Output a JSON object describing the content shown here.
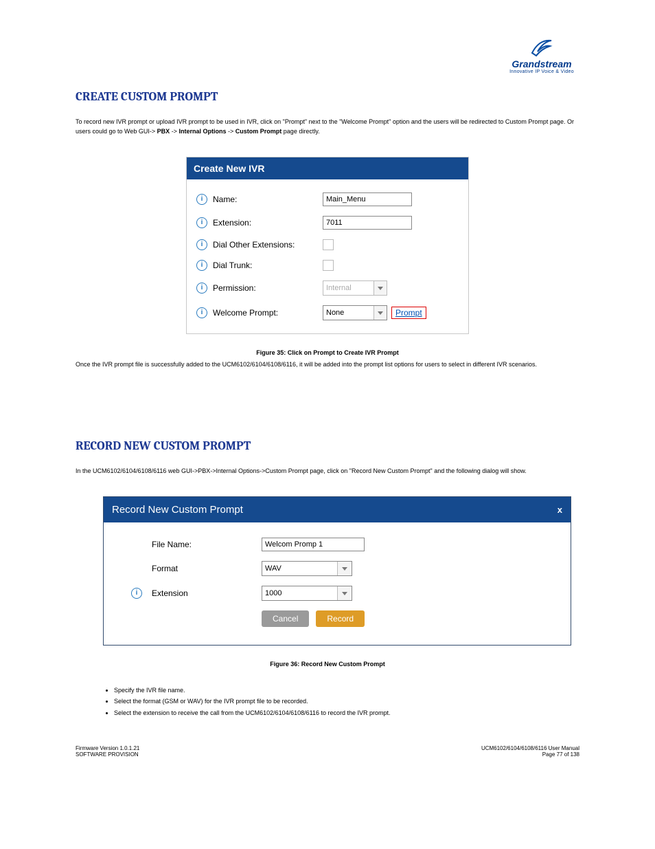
{
  "logo": {
    "brand": "Grandstream",
    "tagline": "Innovative IP Voice & Video"
  },
  "section1": {
    "heading": "CREATE CUSTOM PROMPT",
    "para1_a": "To record new IVR prompt or upload IVR prompt to be used in IVR, click on \"Prompt\" next to the \"Welcome Prompt\" option and the users will be redirected to Custom Prompt page. Or users could go to Web GUI->",
    "para1_b": "PBX",
    "para1_c": "->",
    "para1_d": "Internal Options",
    "para1_e": "->",
    "para1_f": "Custom Prompt",
    "para1_g": " page directly."
  },
  "ivr": {
    "title": "Create New IVR",
    "fields": {
      "name_label": "Name:",
      "name_value": "Main_Menu",
      "ext_label": "Extension:",
      "ext_value": "7011",
      "dial_other_label": "Dial Other Extensions:",
      "dial_trunk_label": "Dial Trunk:",
      "permission_label": "Permission:",
      "permission_value": "Internal",
      "welcome_label": "Welcome Prompt:",
      "welcome_value": "None",
      "prompt_link": "Prompt"
    }
  },
  "fig1": "Figure 35: Click on Prompt to Create IVR Prompt",
  "mid_para": "Once the IVR prompt file is successfully added to the UCM6102/6104/6108/6116, it will be added into the prompt list options for users to select in different IVR scenarios.",
  "section2": {
    "heading": "RECORD NEW CUSTOM PROMPT",
    "para": "In the UCM6102/6104/6108/6116 web GUI->PBX->Internal Options->Custom Prompt page, click on \"Record New Custom Prompt\" and the following dialog will show."
  },
  "rec": {
    "title": "Record New Custom Prompt",
    "close": "x",
    "file_label": "File Name:",
    "file_value": "Welcom Promp 1",
    "format_label": "Format",
    "format_value": "WAV",
    "ext_label": "Extension",
    "ext_value": "1000",
    "cancel": "Cancel",
    "record": "Record"
  },
  "fig2": "Figure 36: Record New Custom Prompt",
  "bullets": {
    "b1": "Specify the IVR file name.",
    "b2": "Select the format (GSM or WAV) for the IVR prompt file to be recorded.",
    "b3": "Select the extension to receive the call from the UCM6102/6104/6108/6116 to record the IVR prompt."
  },
  "footer": {
    "left1": "Firmware Version 1.0.1.21",
    "left2": "SOFTWARE PROVISION",
    "right1": "UCM6102/6104/6108/6116 User Manual",
    "right2": "Page 77 of 138"
  }
}
